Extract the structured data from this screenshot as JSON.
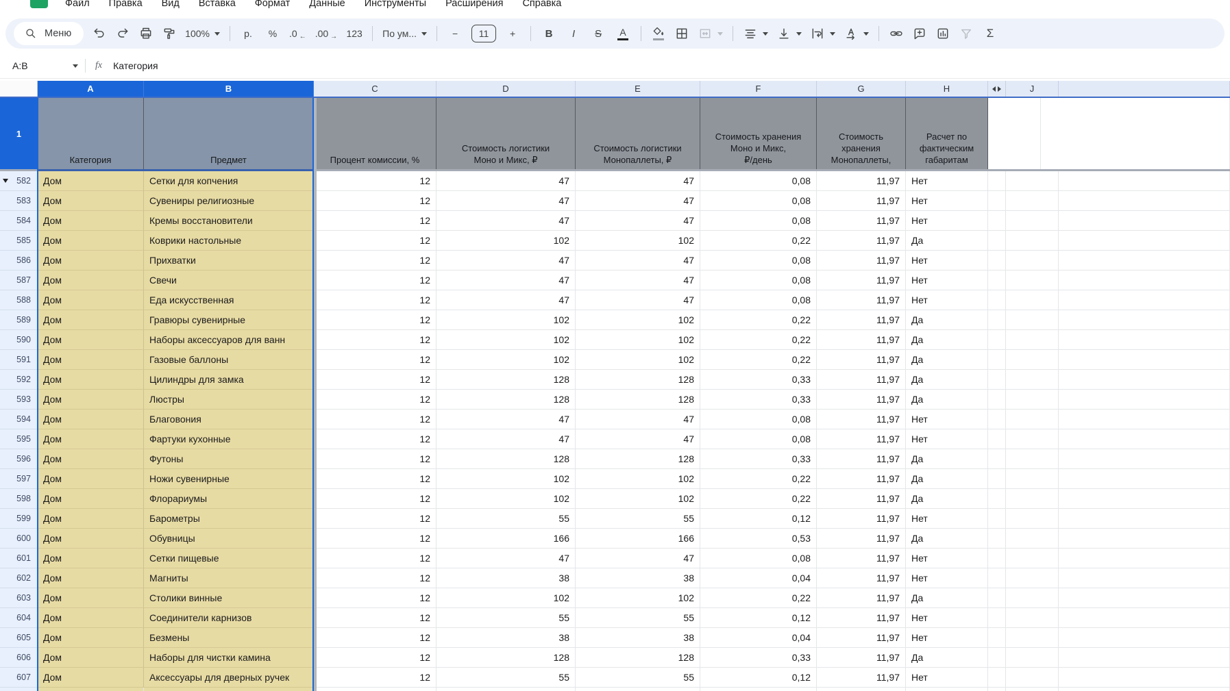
{
  "menu_bar": {
    "items": [
      "Файл",
      "Правка",
      "Вид",
      "Вставка",
      "Формат",
      "Данные",
      "Инструменты",
      "Расширения",
      "Справка"
    ]
  },
  "toolbar": {
    "search": "Меню",
    "zoom": "100%",
    "currency": "р.",
    "percent": "%",
    "decrease_decimals": ".0",
    "decrease_arrow": "←",
    "increase_decimals": ".00",
    "increase_arrow": "→",
    "number_format": "123",
    "font": "По ум...",
    "font_size": "11",
    "minus": "−",
    "plus": "+",
    "bold": "B",
    "italic": "I",
    "strikethrough": "S",
    "text_color": "A",
    "functions": "Σ"
  },
  "formula_bar": {
    "name_box": "A:B",
    "fx": "fx",
    "value": "Категория"
  },
  "colors": {
    "selection_blue": "#1a66d8",
    "header_row_gray": "#90959c",
    "selected_header_gray": "#8695a9",
    "row_fill_tan": "#e7dba4",
    "logo_green": "#1ea362",
    "row_number_bg": "#e8f0fd",
    "column_header_bg": "#e3eaf7"
  },
  "grid": {
    "letters": {
      "a": "A",
      "b": "B",
      "c": "C",
      "d": "D",
      "e": "E",
      "f": "F",
      "g": "G",
      "h": "H",
      "j": "J"
    },
    "header_row": {
      "n": "1",
      "a": "Категория",
      "b": "Предмет",
      "c": "Процент комиссии, %",
      "d": "Стоимость логистики\nМоно и Микс, ₽",
      "e": "Стоимость логистики\nМонопаллеты, ₽",
      "f": "Стоимость хранения\nМоно и Микс,\n₽/день",
      "g": "Стоимость\nхранения\nМонопаллеты,",
      "h": "Расчет по\nфактическим\nгабаритам"
    },
    "rows": [
      {
        "n": "582",
        "marker": true,
        "a": "Дом",
        "b": "Сетки для копчения",
        "c": "12",
        "d": "47",
        "e": "47",
        "f": "0,08",
        "g": "11,97",
        "h": "Нет",
        "j": "",
        "k": ""
      },
      {
        "n": "583",
        "a": "Дом",
        "b": "Сувениры религиозные",
        "c": "12",
        "d": "47",
        "e": "47",
        "f": "0,08",
        "g": "11,97",
        "h": "Нет",
        "j": "",
        "k": ""
      },
      {
        "n": "584",
        "a": "Дом",
        "b": "Кремы восстановители",
        "c": "12",
        "d": "47",
        "e": "47",
        "f": "0,08",
        "g": "11,97",
        "h": "Нет",
        "j": "",
        "k": ""
      },
      {
        "n": "585",
        "a": "Дом",
        "b": "Коврики настольные",
        "c": "12",
        "d": "102",
        "e": "102",
        "f": "0,22",
        "g": "11,97",
        "h": "Да",
        "j": "",
        "k": ""
      },
      {
        "n": "586",
        "a": "Дом",
        "b": "Прихватки",
        "c": "12",
        "d": "47",
        "e": "47",
        "f": "0,08",
        "g": "11,97",
        "h": "Нет",
        "j": "",
        "k": ""
      },
      {
        "n": "587",
        "a": "Дом",
        "b": "Свечи",
        "c": "12",
        "d": "47",
        "e": "47",
        "f": "0,08",
        "g": "11,97",
        "h": "Нет",
        "j": "",
        "k": ""
      },
      {
        "n": "588",
        "a": "Дом",
        "b": "Еда искусственная",
        "c": "12",
        "d": "47",
        "e": "47",
        "f": "0,08",
        "g": "11,97",
        "h": "Нет",
        "j": "",
        "k": ""
      },
      {
        "n": "589",
        "a": "Дом",
        "b": "Гравюры сувенирные",
        "c": "12",
        "d": "102",
        "e": "102",
        "f": "0,22",
        "g": "11,97",
        "h": "Да",
        "j": "",
        "k": ""
      },
      {
        "n": "590",
        "a": "Дом",
        "b": "Наборы аксессуаров для ванн",
        "c": "12",
        "d": "102",
        "e": "102",
        "f": "0,22",
        "g": "11,97",
        "h": "Да",
        "j": "",
        "k": ""
      },
      {
        "n": "591",
        "a": "Дом",
        "b": "Газовые баллоны",
        "c": "12",
        "d": "102",
        "e": "102",
        "f": "0,22",
        "g": "11,97",
        "h": "Да",
        "j": "",
        "k": ""
      },
      {
        "n": "592",
        "a": "Дом",
        "b": "Цилиндры для замка",
        "c": "12",
        "d": "128",
        "e": "128",
        "f": "0,33",
        "g": "11,97",
        "h": "Да",
        "j": "",
        "k": ""
      },
      {
        "n": "593",
        "a": "Дом",
        "b": "Люстры",
        "c": "12",
        "d": "128",
        "e": "128",
        "f": "0,33",
        "g": "11,97",
        "h": "Да",
        "j": "",
        "k": ""
      },
      {
        "n": "594",
        "a": "Дом",
        "b": "Благовония",
        "c": "12",
        "d": "47",
        "e": "47",
        "f": "0,08",
        "g": "11,97",
        "h": "Нет",
        "j": "",
        "k": ""
      },
      {
        "n": "595",
        "a": "Дом",
        "b": "Фартуки кухонные",
        "c": "12",
        "d": "47",
        "e": "47",
        "f": "0,08",
        "g": "11,97",
        "h": "Нет",
        "j": "",
        "k": ""
      },
      {
        "n": "596",
        "a": "Дом",
        "b": "Футоны",
        "c": "12",
        "d": "128",
        "e": "128",
        "f": "0,33",
        "g": "11,97",
        "h": "Да",
        "j": "",
        "k": ""
      },
      {
        "n": "597",
        "a": "Дом",
        "b": "Ножи сувенирные",
        "c": "12",
        "d": "102",
        "e": "102",
        "f": "0,22",
        "g": "11,97",
        "h": "Да",
        "j": "",
        "k": ""
      },
      {
        "n": "598",
        "a": "Дом",
        "b": "Флорариумы",
        "c": "12",
        "d": "102",
        "e": "102",
        "f": "0,22",
        "g": "11,97",
        "h": "Да",
        "j": "",
        "k": ""
      },
      {
        "n": "599",
        "a": "Дом",
        "b": "Барометры",
        "c": "12",
        "d": "55",
        "e": "55",
        "f": "0,12",
        "g": "11,97",
        "h": "Нет",
        "j": "",
        "k": ""
      },
      {
        "n": "600",
        "a": "Дом",
        "b": "Обувницы",
        "c": "12",
        "d": "166",
        "e": "166",
        "f": "0,53",
        "g": "11,97",
        "h": "Да",
        "j": "",
        "k": ""
      },
      {
        "n": "601",
        "a": "Дом",
        "b": "Сетки пищевые",
        "c": "12",
        "d": "47",
        "e": "47",
        "f": "0,08",
        "g": "11,97",
        "h": "Нет",
        "j": "",
        "k": ""
      },
      {
        "n": "602",
        "a": "Дом",
        "b": "Магниты",
        "c": "12",
        "d": "38",
        "e": "38",
        "f": "0,04",
        "g": "11,97",
        "h": "Нет",
        "j": "",
        "k": ""
      },
      {
        "n": "603",
        "a": "Дом",
        "b": "Столики винные",
        "c": "12",
        "d": "102",
        "e": "102",
        "f": "0,22",
        "g": "11,97",
        "h": "Да",
        "j": "",
        "k": ""
      },
      {
        "n": "604",
        "a": "Дом",
        "b": "Соединители карнизов",
        "c": "12",
        "d": "55",
        "e": "55",
        "f": "0,12",
        "g": "11,97",
        "h": "Нет",
        "j": "",
        "k": ""
      },
      {
        "n": "605",
        "a": "Дом",
        "b": "Безмены",
        "c": "12",
        "d": "38",
        "e": "38",
        "f": "0,04",
        "g": "11,97",
        "h": "Нет",
        "j": "",
        "k": ""
      },
      {
        "n": "606",
        "a": "Дом",
        "b": "Наборы для чистки камина",
        "c": "12",
        "d": "128",
        "e": "128",
        "f": "0,33",
        "g": "11,97",
        "h": "Да",
        "j": "",
        "k": ""
      },
      {
        "n": "607",
        "a": "Дом",
        "b": "Аксессуары для дверных ручек",
        "c": "12",
        "d": "55",
        "e": "55",
        "f": "0,12",
        "g": "11,97",
        "h": "Нет",
        "j": "",
        "k": ""
      }
    ]
  }
}
